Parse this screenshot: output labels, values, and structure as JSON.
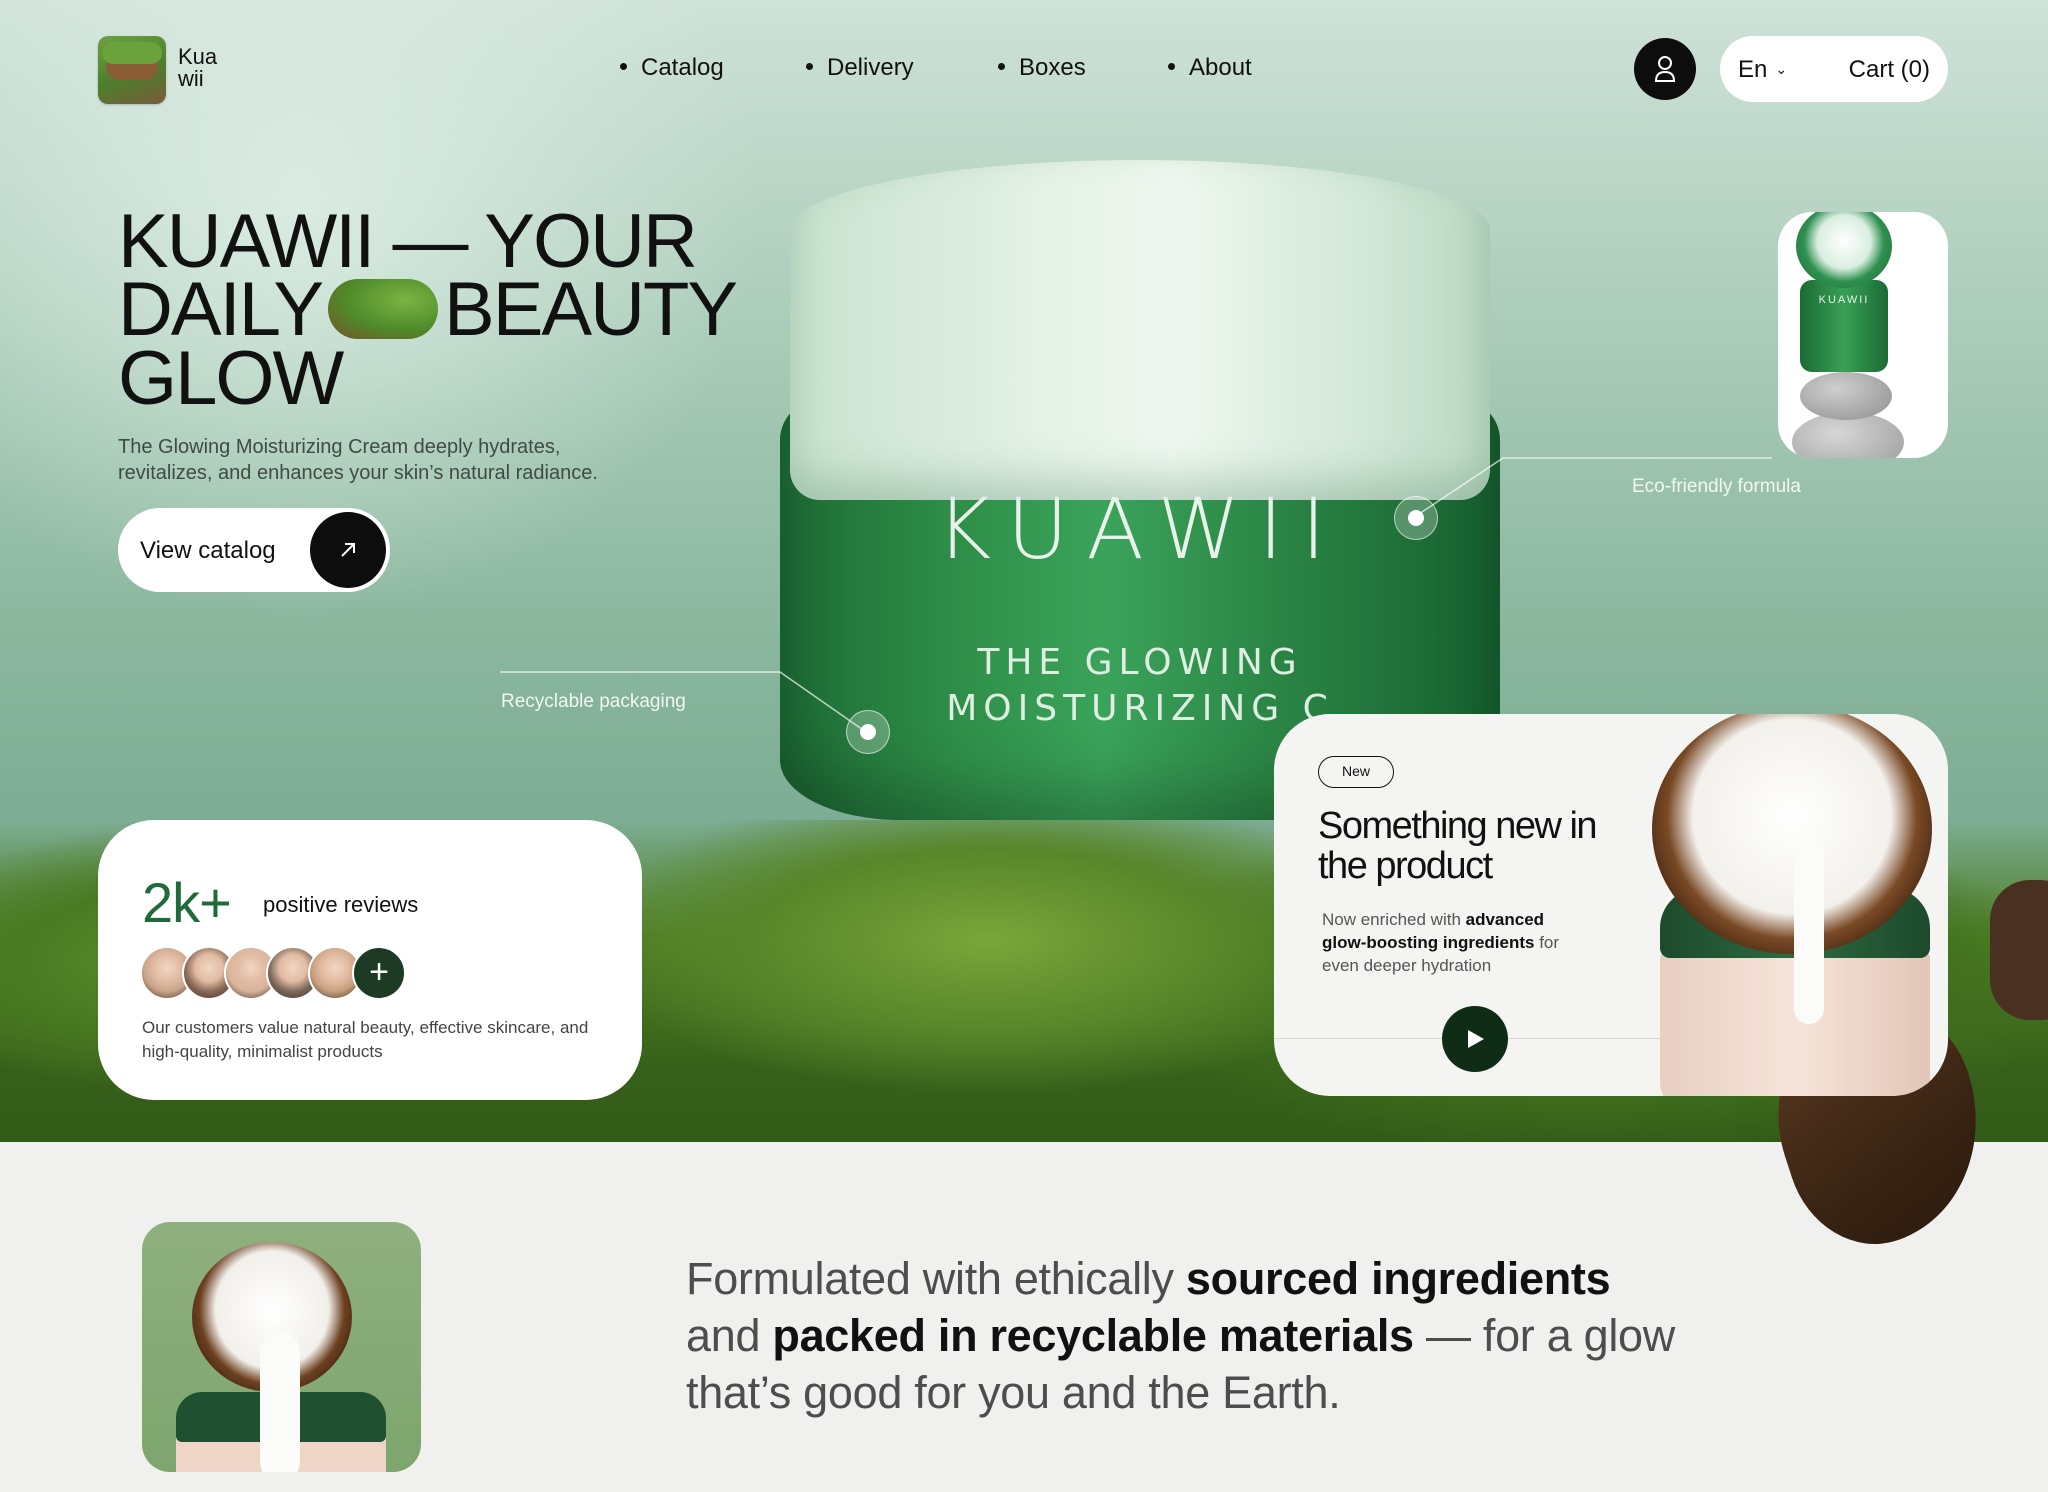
{
  "brand": {
    "logo_text": "Kua\nwii"
  },
  "nav": {
    "items": [
      {
        "label": "Catalog"
      },
      {
        "label": "Delivery"
      },
      {
        "label": "Boxes"
      },
      {
        "label": "About"
      }
    ]
  },
  "header": {
    "language": "En",
    "cart_label": "Cart (0)"
  },
  "hero": {
    "headline_line1": "KUAWII — YOUR",
    "headline_line2a": "DAILY",
    "headline_line2b": "BEAUTY",
    "headline_line3": "GLOW",
    "description": "The Glowing Moisturizing Cream deeply hydrates, revitalizes, and enhances your skin’s natural radiance.",
    "cta_label": "View catalog",
    "jar_brand": "KUAWII",
    "jar_subtitle_line1": "THE GLOWING",
    "jar_subtitle_line2": "MOISTURIZING C",
    "hotspots": [
      {
        "label": "Recyclable packaging"
      },
      {
        "label": "Eco-friendly formula"
      }
    ],
    "thumb_jar_label": "KUAWII"
  },
  "reviews": {
    "count": "2k+",
    "label": "positive reviews",
    "plus": "+",
    "description": "Our customers value natural beauty, effective skincare, and high-quality, minimalist products",
    "avatar_colors": [
      "#c9a58a",
      "#8a6a58",
      "#d8b49c",
      "#7e6a5c",
      "#c7a07f"
    ]
  },
  "new_product": {
    "badge": "New",
    "title": "Something new in the product",
    "desc_part1": "Now enriched with ",
    "desc_bold": "advanced glow-boosting ingredients",
    "desc_part2": " for even deeper hydration"
  },
  "statement": {
    "part1": "Formulated with ethically ",
    "bold1": "sourced ingredients",
    "part2": " and ",
    "bold2": "packed in recyclable materials",
    "part3": " — for a glow that’s good for you and the Earth."
  },
  "colors": {
    "accent_green": "#1f6b3a",
    "dark": "#0d0d0d",
    "play_button": "#0f2c17"
  },
  "icons": [
    "user-icon",
    "chevron-down-icon",
    "arrow-up-right-icon",
    "play-icon",
    "plus-icon"
  ]
}
